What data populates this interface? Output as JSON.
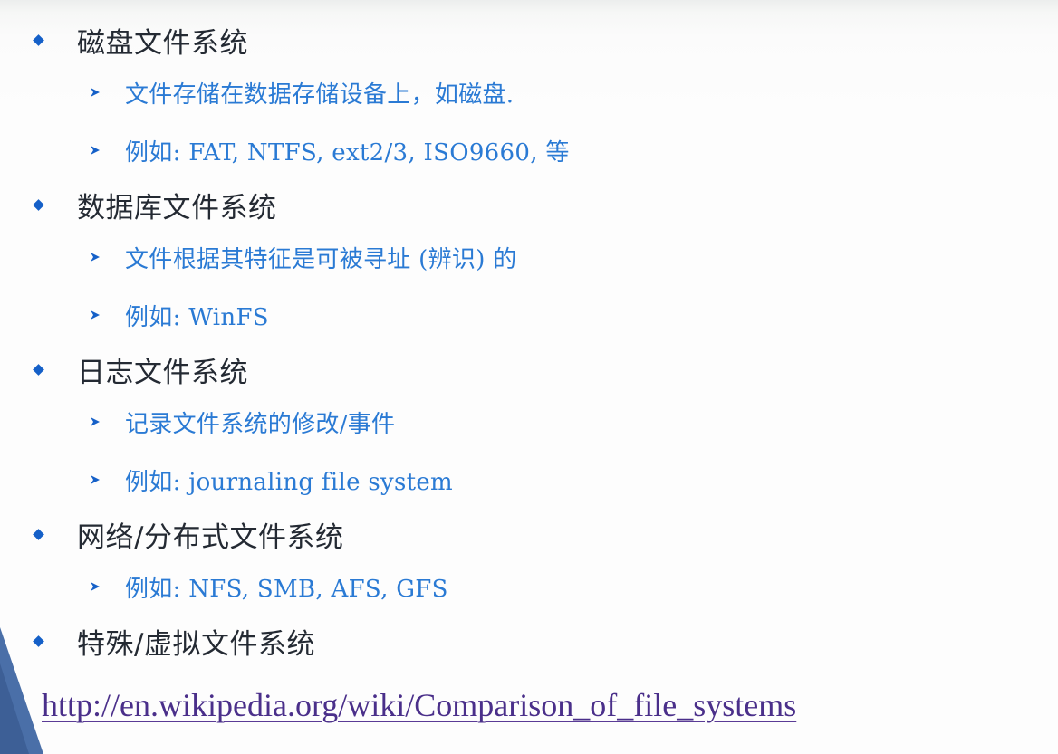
{
  "slide": {
    "items": [
      {
        "title": "磁盘文件系统",
        "subitems": [
          "文件存储在数据存储设备上，如磁盘.",
          "例如: FAT, NTFS, ext2/3, ISO9660, 等"
        ]
      },
      {
        "title": "数据库文件系统",
        "subitems": [
          "文件根据其特征是可被寻址 (辨识) 的",
          "例如: WinFS"
        ]
      },
      {
        "title": "日志文件系统",
        "subitems": [
          "记录文件系统的修改/事件",
          "例如: journaling file system"
        ]
      },
      {
        "title": "网络/分布式文件系统",
        "subitems": [
          "例如: NFS, SMB, AFS, GFS"
        ]
      },
      {
        "title": "特殊/虚拟文件系统",
        "subitems": []
      }
    ],
    "link": "http://en.wikipedia.org/wiki/Comparison_of_file_systems"
  },
  "icons": {
    "level1_bullet": "diamond-bullet-icon",
    "level2_bullet": "arrow-bullet-icon"
  },
  "colors": {
    "bullet": "#1560c8",
    "heading_text": "#242a33",
    "subitem_text": "#2a7ad4",
    "link": "#4a2f8a"
  }
}
